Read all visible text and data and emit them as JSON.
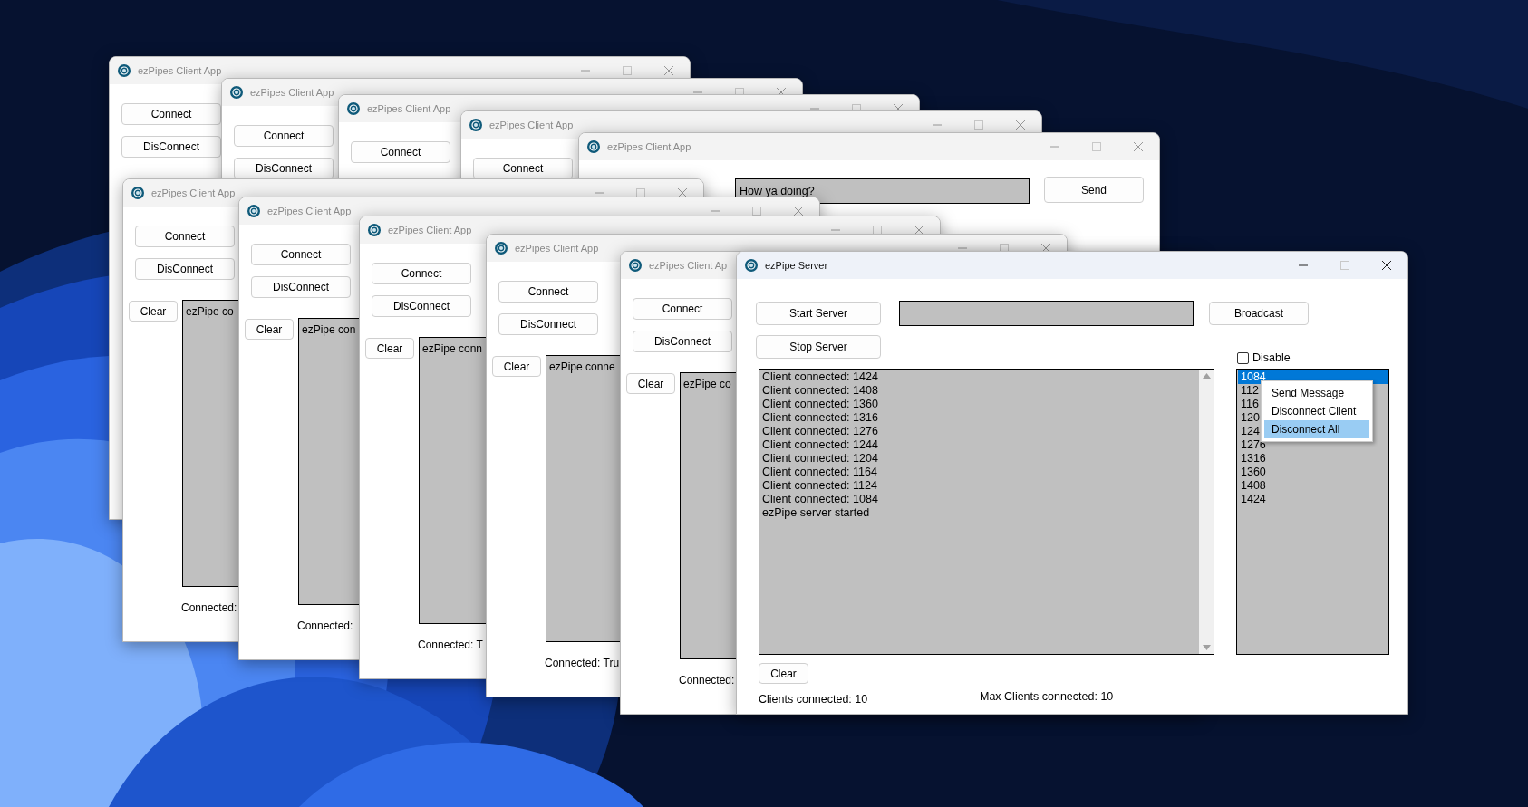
{
  "windows": [
    {
      "kind": "client",
      "title": "ezPipes Client App",
      "active": false,
      "controls": true,
      "connect": "Connect",
      "disconnect": "DisConnect"
    },
    {
      "kind": "client",
      "title": "ezPipes Client App",
      "active": false,
      "controls": true,
      "connect": "Connect",
      "disconnect": "DisConnect"
    },
    {
      "kind": "client",
      "title": "ezPipes Client App",
      "active": false,
      "controls": true,
      "connect": "Connect"
    },
    {
      "kind": "client",
      "title": "ezPipes Client App",
      "active": false,
      "controls": true,
      "connect": "Connect"
    },
    {
      "kind": "client",
      "title": "ezPipes Client App",
      "active": false,
      "controls": true,
      "message": "How ya doing?",
      "send": "Send"
    },
    {
      "kind": "client",
      "title": "ezPipes Client App",
      "active": false,
      "controls": true,
      "connect": "Connect",
      "disconnect": "DisConnect",
      "clear": "Clear",
      "log": "ezPipe co",
      "status": "Connected:"
    },
    {
      "kind": "client",
      "title": "ezPipes Client App",
      "active": false,
      "controls": true,
      "connect": "Connect",
      "disconnect": "DisConnect",
      "clear": "Clear",
      "log": "ezPipe con",
      "status": "Connected:"
    },
    {
      "kind": "client",
      "title": "ezPipes Client App",
      "active": false,
      "controls": true,
      "connect": "Connect",
      "disconnect": "DisConnect",
      "clear": "Clear",
      "log": "ezPipe conn",
      "status": "Connected: T"
    },
    {
      "kind": "client",
      "title": "ezPipes Client App",
      "active": false,
      "controls": true,
      "connect": "Connect",
      "disconnect": "DisConnect",
      "clear": "Clear",
      "log": "ezPipe conne",
      "status": "Connected: Tru"
    },
    {
      "kind": "client",
      "title": "ezPipes Client Ap",
      "active": false,
      "connect": "Connect",
      "disconnect": "DisConnect",
      "clear": "Clear",
      "log": "ezPipe co",
      "status": "Connected:"
    },
    {
      "kind": "server",
      "title": "ezPipe Server",
      "active": true,
      "controls": true,
      "start": "Start Server",
      "stop": "Stop Server",
      "broadcast": "Broadcast",
      "disable": {
        "label": "Disable",
        "checked": false
      },
      "log": [
        "Client connected: 1424",
        "Client connected: 1408",
        "Client connected: 1360",
        "Client connected: 1316",
        "Client connected: 1276",
        "Client connected: 1244",
        "Client connected: 1204",
        "Client connected: 1164",
        "Client connected: 1124",
        "Client connected: 1084",
        "ezPipe server started"
      ],
      "clients": [
        {
          "label": "1084",
          "selected": true
        },
        {
          "label": "112",
          "selected": false
        },
        {
          "label": "116",
          "selected": false
        },
        {
          "label": "120",
          "selected": false
        },
        {
          "label": "124",
          "selected": false
        },
        {
          "label": "1276",
          "selected": false
        },
        {
          "label": "1316",
          "selected": false
        },
        {
          "label": "1360",
          "selected": false
        },
        {
          "label": "1408",
          "selected": false
        },
        {
          "label": "1424",
          "selected": false
        }
      ],
      "menu": [
        {
          "label": "Send Message",
          "selected": false
        },
        {
          "label": "Disconnect Client",
          "selected": false
        },
        {
          "label": "Disconnect All",
          "selected": true
        }
      ],
      "clear": "Clear",
      "clients_connected": "Clients connected: 10",
      "max_clients": "Max Clients connected: 10"
    }
  ]
}
